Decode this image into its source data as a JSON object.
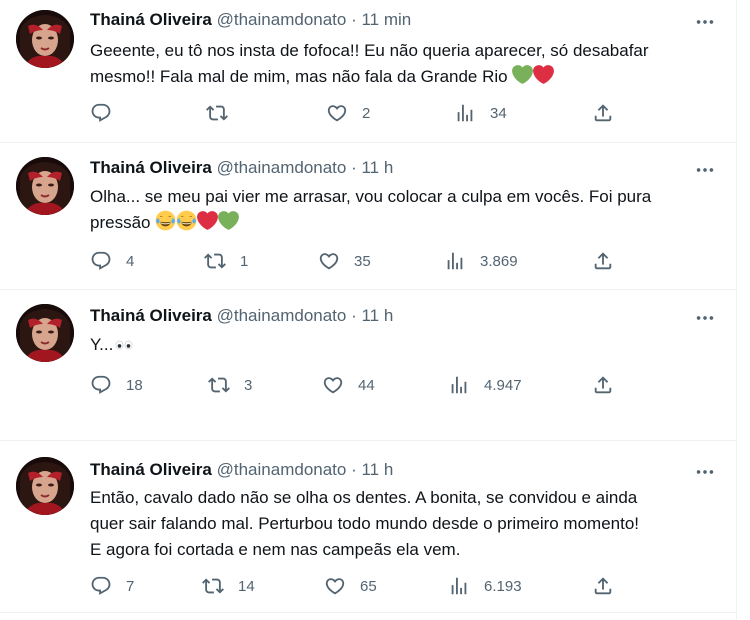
{
  "tweets": [
    {
      "name": "Thainá Oliveira",
      "handle": "@thainamdonato",
      "time": "· 11 min",
      "text1": "Geeente, eu tô nos insta de fofoca!! Eu não queria aparecer, só desabafar",
      "text2": "mesmo!! Fala mal de mim, mas não fala da Grande Rio",
      "emojis": [
        "green-heart",
        "red-heart"
      ],
      "replies": "",
      "retweets": "",
      "likes": "2",
      "views": "34"
    },
    {
      "name": "Thainá Oliveira",
      "handle": "@thainamdonato",
      "time": "· 11 h",
      "text1": "Olha... se meu pai vier me arrasar, vou colocar a culpa em vocês. Foi pura",
      "text2": "pressão",
      "emojis": [
        "tears-of-joy",
        "tears-of-joy",
        "red-heart",
        "green-heart"
      ],
      "replies": "4",
      "retweets": "1",
      "likes": "35",
      "views": "3.869"
    },
    {
      "name": "Thainá Oliveira",
      "handle": "@thainamdonato",
      "time": "· 11 h",
      "text1": "Y...",
      "emojis": [
        "eyes"
      ],
      "replies": "18",
      "retweets": "3",
      "likes": "44",
      "views": "4.947"
    },
    {
      "name": "Thainá Oliveira",
      "handle": "@thainamdonato",
      "time": "· 11 h",
      "text1": "Então, cavalo dado não se olha os dentes. A bonita, se convidou e ainda",
      "text2": "quer sair falando mal. Perturbou todo mundo desde o primeiro momento!",
      "text3": "E agora foi cortada e nem nas campeãs ela vem.",
      "replies": "7",
      "retweets": "14",
      "likes": "65",
      "views": "6.193"
    }
  ],
  "colors": {
    "text": "#0f1419",
    "muted": "#536471",
    "divider": "#eff3f4"
  }
}
